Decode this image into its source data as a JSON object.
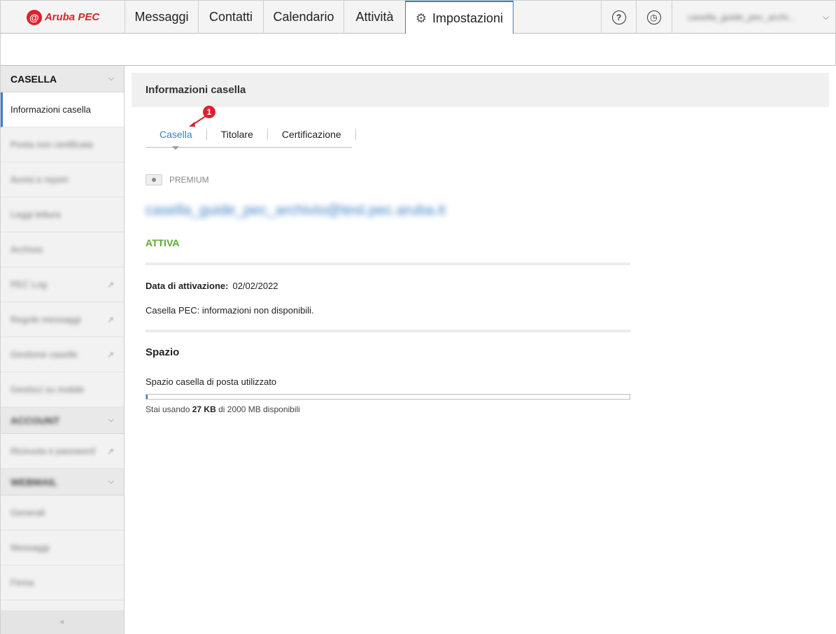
{
  "app": {
    "logo_mark": "@",
    "logo_text": "Aruba PEC"
  },
  "nav": {
    "tabs": [
      {
        "label": "Messaggi"
      },
      {
        "label": "Contatti"
      },
      {
        "label": "Calendario"
      },
      {
        "label": "Attività"
      },
      {
        "label": "Impostazioni",
        "active": true
      }
    ],
    "help_icon": "question-icon",
    "history_icon": "history-icon",
    "account_name": "casella_guide_pec_archi..."
  },
  "sidebar": {
    "section_casella": "CASELLA",
    "active_item": "Informazioni casella",
    "items": [
      {
        "label": "Posta non certificata"
      },
      {
        "label": "Avvisi e report"
      },
      {
        "label": "Leggi lettura"
      },
      {
        "label": "Archivio"
      },
      {
        "label": "PEC Log"
      },
      {
        "label": "Regole messaggi"
      },
      {
        "label": "Gestione caselle"
      },
      {
        "label": "Gestisci su mobile"
      }
    ],
    "section_account": "ACCOUNT",
    "account_item": "Ricevuta e password",
    "section_webmail": "WEBMAIL",
    "webmail_items": [
      {
        "label": "Generali"
      },
      {
        "label": "Messaggi"
      },
      {
        "label": "Firma"
      }
    ],
    "footer": "«"
  },
  "content": {
    "header": "Informazioni casella",
    "tabs": [
      {
        "label": "Casella",
        "active": true
      },
      {
        "label": "Titolare"
      },
      {
        "label": "Certificazione"
      }
    ],
    "callout": "1",
    "plan": "PREMIUM",
    "email": "casella_guide_pec_archivio@test.pec.aruba.it",
    "status": "ATTIVA",
    "activation_label": "Data di attivazione:",
    "activation_date": "02/02/2022",
    "pec_info": "Casella PEC: informazioni non disponibili.",
    "space_title": "Spazio",
    "space_label": "Spazio casella di posta utilizzato",
    "usage_prefix": "Stai usando",
    "usage_amount": "27 KB",
    "usage_suffix": "di 2000 MB disponibili",
    "usage_fraction": 1.35e-05
  },
  "colors": {
    "accent": "#3b7fc4",
    "brand": "#d9232d",
    "active_status": "#5cab2f"
  }
}
